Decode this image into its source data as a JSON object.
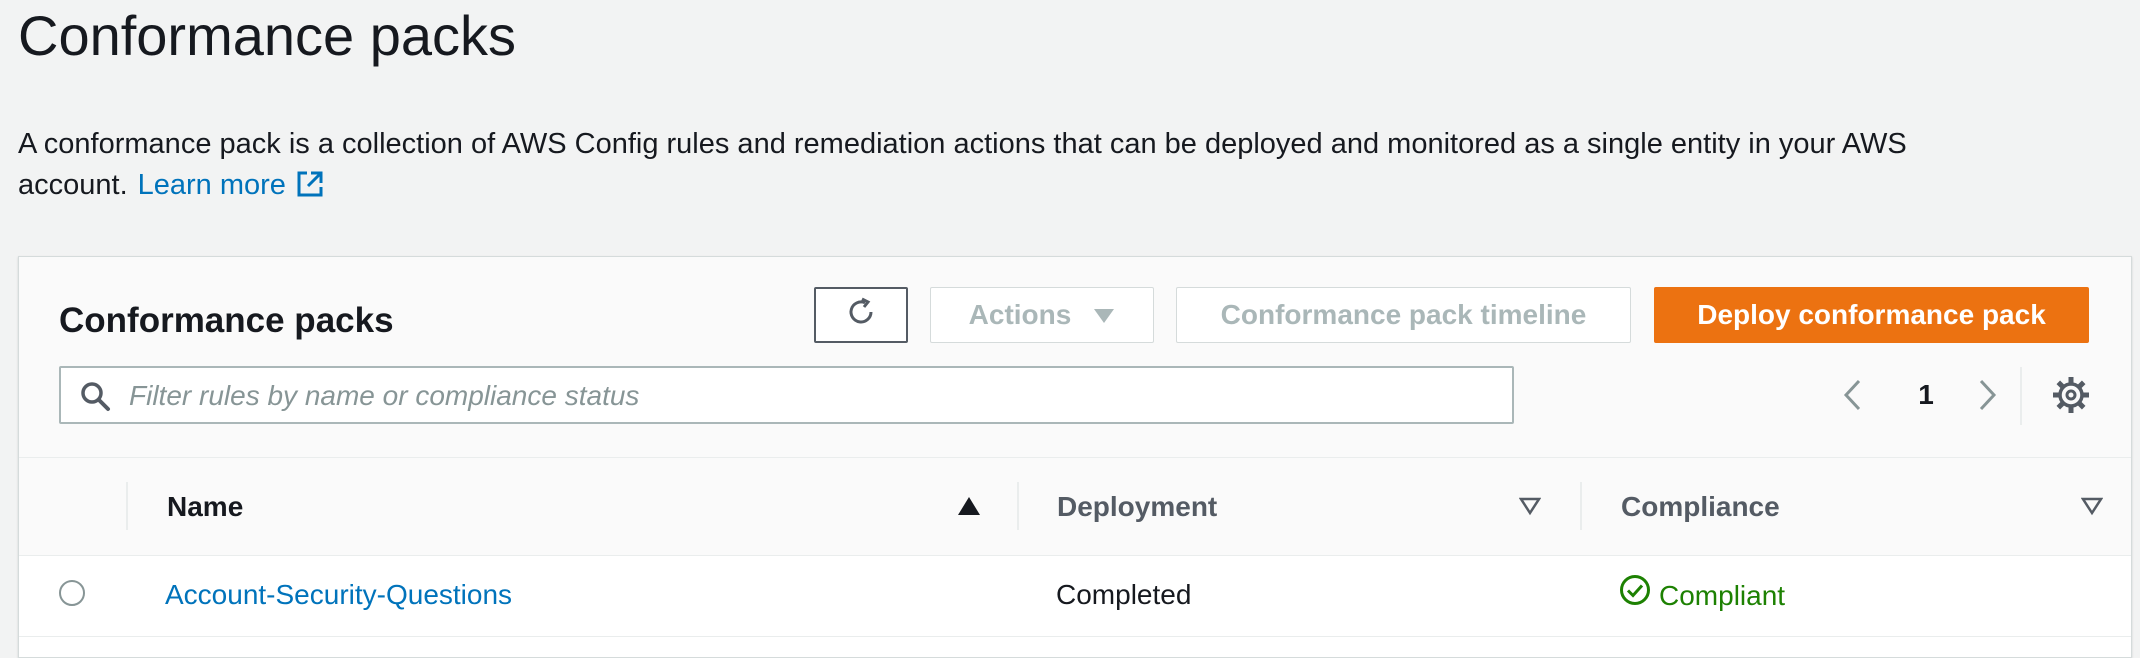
{
  "page": {
    "title": "Conformance packs",
    "description": "A conformance pack is a collection of AWS Config rules and remediation actions that can be deployed and monitored as a single entity in your AWS account.",
    "learn_more": "Learn more"
  },
  "container": {
    "title": "Conformance packs",
    "buttons": {
      "actions": "Actions",
      "timeline": "Conformance pack timeline",
      "deploy": "Deploy conformance pack"
    },
    "search": {
      "placeholder": "Filter rules by name or compliance status",
      "value": ""
    },
    "pagination": {
      "current_page": "1"
    }
  },
  "table": {
    "columns": {
      "name": "Name",
      "deployment": "Deployment",
      "compliance": "Compliance"
    },
    "sort": {
      "column": "name",
      "direction": "ascending"
    },
    "rows": [
      {
        "name": "Account-Security-Questions",
        "deployment": "Completed",
        "compliance": "Compliant"
      }
    ]
  },
  "icons": {
    "external_link": "external-link-icon",
    "refresh": "refresh-icon",
    "actions_dropdown": "caret-down-icon",
    "search": "search-icon",
    "prev": "chevron-left-icon",
    "next": "chevron-right-icon",
    "settings": "gear-icon",
    "sort_asc": "sort-ascending-icon",
    "sort_filter": "sort-caret-icon",
    "compliant": "check-circle-icon"
  },
  "colors": {
    "link": "#0073bb",
    "primary_button": "#ec7211",
    "disabled_text": "#aab7b8",
    "compliant": "#1d8102",
    "background": "#f2f3f3"
  }
}
